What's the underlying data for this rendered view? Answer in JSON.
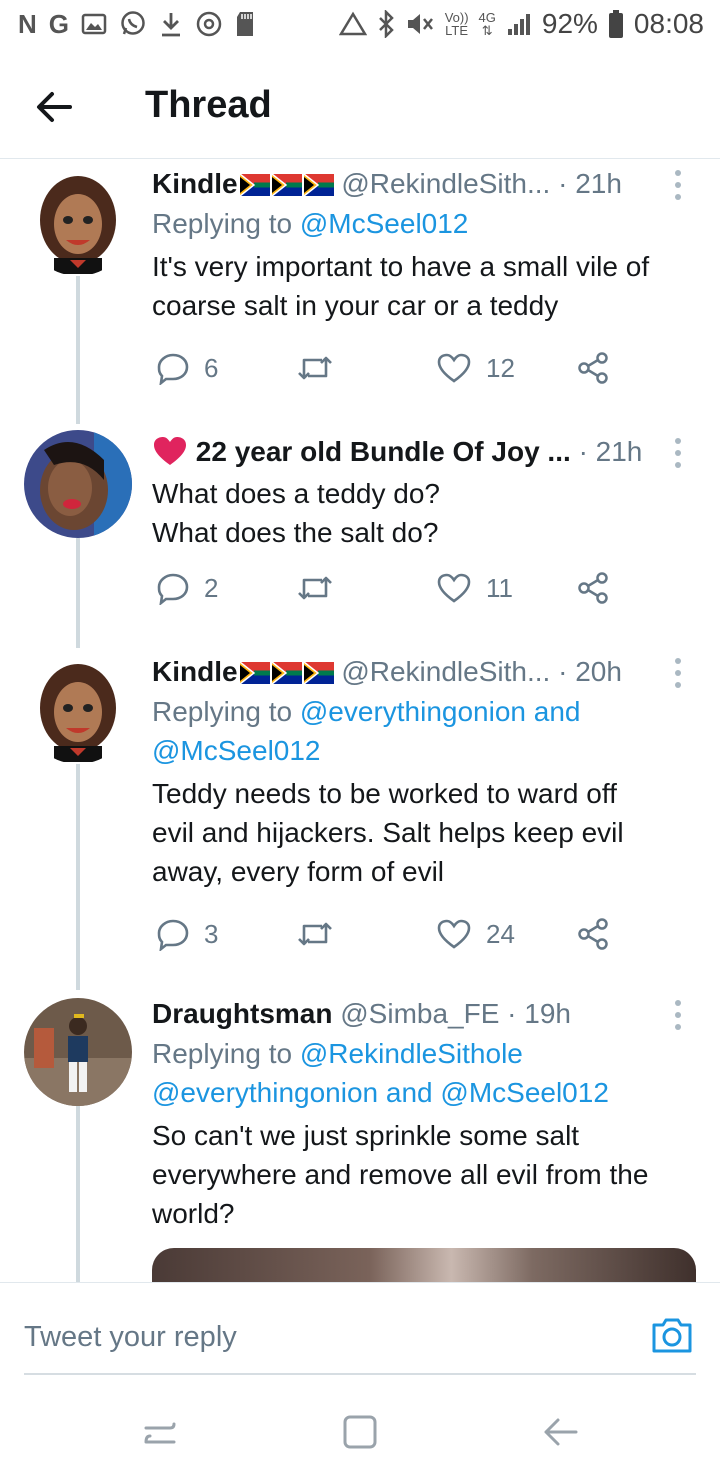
{
  "status_bar": {
    "left_glyphs": [
      "N",
      "G"
    ],
    "network_type_top": "Vo))",
    "network_type_bottom": "LTE",
    "signal_label": "4G",
    "battery": "92%",
    "time": "08:08"
  },
  "header": {
    "title": "Thread"
  },
  "tweets": [
    {
      "name": "Kindle",
      "flags": 3,
      "handle": "@RekindleSith...",
      "time": "· 21h",
      "replying_prefix": "Replying to ",
      "replying_to": "@McSeel012",
      "text_lines": [
        "It's very important to have a small vile of",
        "coarse salt in your car or a teddy"
      ],
      "replies": "6",
      "retweets": "",
      "likes": "12"
    },
    {
      "name_prefix_icon": "heart-icon",
      "name": "22 year old Bundle Of Joy ...",
      "time": "· 21h",
      "text_lines": [
        "What does a teddy do?",
        "What does the salt do?"
      ],
      "replies": "2",
      "retweets": "",
      "likes": "11"
    },
    {
      "name": "Kindle",
      "flags": 3,
      "handle": "@RekindleSith...",
      "time": "· 20h",
      "replying_prefix": "Replying to ",
      "replying_line1": "@everythingonion and",
      "replying_line2": "@McSeel012",
      "text_lines": [
        "Teddy needs to be worked to ward off",
        "evil and hijackers. Salt helps keep evil",
        "away, every form of evil"
      ],
      "replies": "3",
      "retweets": "",
      "likes": "24"
    },
    {
      "name": "Draughtsman",
      "handle": "@Simba_FE",
      "time": "· 19h",
      "replying_prefix": "Replying to ",
      "replying_line1": "@RekindleSithole",
      "replying_line2": "@everythingonion and @McSeel012",
      "text_lines": [
        "So can't we just sprinkle some salt",
        "everywhere and remove all evil from the",
        "world?"
      ]
    }
  ],
  "compose": {
    "placeholder": "Tweet your reply"
  },
  "colors": {
    "link": "#1b95e0",
    "secondary_text": "#657786",
    "like_heart": "#e0245e"
  }
}
